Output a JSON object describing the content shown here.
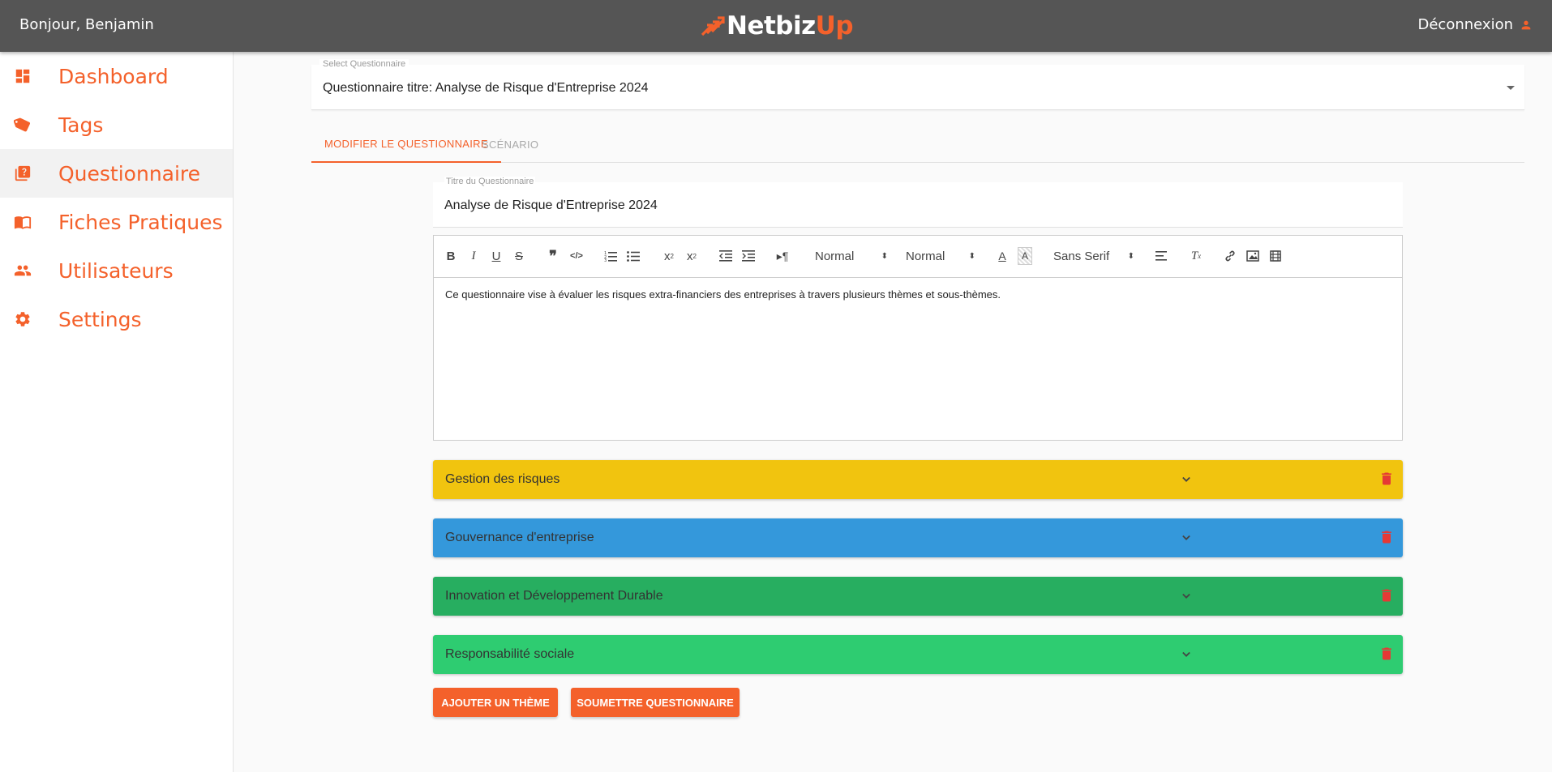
{
  "header": {
    "greeting": "Bonjour, Benjamin",
    "logo_part1": "Netbiz",
    "logo_part2": "Up",
    "logout_label": "Déconnexion",
    "brand_color": "#f4612b"
  },
  "sidebar": {
    "items": [
      {
        "label": "Dashboard",
        "icon": "dashboard-icon",
        "active": false
      },
      {
        "label": "Tags",
        "icon": "tags-icon",
        "active": false
      },
      {
        "label": "Questionnaire",
        "icon": "quiz-icon",
        "active": true
      },
      {
        "label": "Fiches Pratiques",
        "icon": "book-icon",
        "active": false
      },
      {
        "label": "Utilisateurs",
        "icon": "users-icon",
        "active": false
      },
      {
        "label": "Settings",
        "icon": "gear-icon",
        "active": false
      }
    ]
  },
  "select": {
    "label": "Select Questionnaire",
    "value": "Questionnaire titre: Analyse de Risque d'Entreprise 2024"
  },
  "tabs": [
    {
      "label": "Modifier le questionnaire",
      "active": true
    },
    {
      "label": "Scénario",
      "active": false
    }
  ],
  "form": {
    "title_label": "Titre du Questionnaire",
    "title_value": "Analyse de Risque d'Entreprise 2024"
  },
  "editor": {
    "toolbar": {
      "header_select": "Normal",
      "size_select": "Normal",
      "font_select": "Sans Serif"
    },
    "content": "Ce questionnaire vise à évaluer les risques extra-financiers des entreprises à travers plusieurs thèmes et sous-thèmes."
  },
  "themes": [
    {
      "label": "Gestion des risques",
      "color": "#f1c40f"
    },
    {
      "label": "Gouvernance d'entreprise",
      "color": "#3498db"
    },
    {
      "label": "Innovation et Développement Durable",
      "color": "#27ae60"
    },
    {
      "label": "Responsabilité sociale",
      "color": "#2ecc71"
    }
  ],
  "actions": {
    "add_theme": "Ajouter un thème",
    "submit": "Soumettre questionnaire"
  }
}
